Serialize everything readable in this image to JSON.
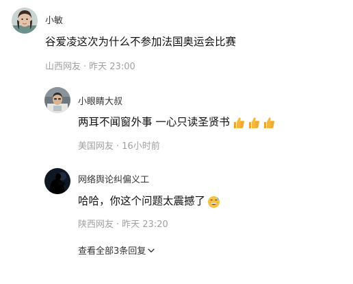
{
  "comments": [
    {
      "username": "小敏",
      "text": "谷爱凌这次为什么不参加法国奥运会比赛",
      "location": "山西网友",
      "separator": "·",
      "time": "昨天 23:00",
      "avatar_icon": "user-avatar-photo-icon"
    },
    {
      "username": "小眼睛大叔",
      "text": "两耳不闻窗外事 一心只读圣贤书",
      "emojis": [
        "thumbs-up-emoji",
        "thumbs-up-emoji",
        "thumbs-up-emoji"
      ],
      "location": "美国网友",
      "separator": "·",
      "time": "16小时前",
      "avatar_icon": "user-avatar-photo-icon"
    },
    {
      "username": "网络舆论纠偏义工",
      "text": "哈哈，你这个问题太震撼了",
      "emojis": [
        "grinning-sweat-emoji"
      ],
      "location": "陕西网友",
      "separator": "·",
      "time": "昨天 23:20",
      "avatar_icon": "user-avatar-photo-icon"
    }
  ],
  "view_all": {
    "label": "查看全部3条回复",
    "icon": "chevron-down-icon"
  },
  "colors": {
    "text_primary": "#111111",
    "username": "#333333",
    "meta": "#a0a0a0",
    "emoji_yellow": "#f6b73c",
    "background": "#ffffff"
  }
}
